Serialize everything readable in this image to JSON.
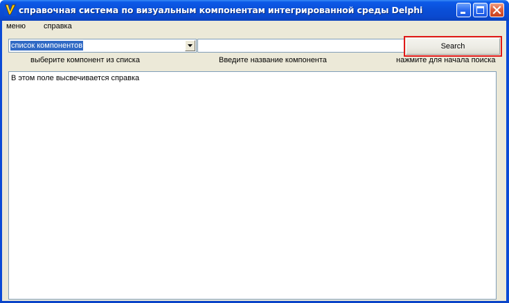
{
  "window": {
    "title": "справочная система по визуальным компонентам интегрированной среды Delphi",
    "icon": "delphi-app-icon",
    "controls": {
      "minimize_icon": "minimize-icon",
      "maximize_icon": "maximize-icon",
      "close_icon": "close-icon"
    },
    "colors": {
      "titlebar": "#0a4fd8",
      "client_bg": "#ece9d8",
      "selection": "#316ac5",
      "highlight_border": "#e01818"
    }
  },
  "menu": {
    "items": [
      {
        "label": "меню"
      },
      {
        "label": "справка"
      }
    ]
  },
  "toolbar": {
    "component_select": {
      "selected": "список компонентов"
    },
    "search_input": {
      "value": "",
      "placeholder": ""
    },
    "search_button": {
      "label": "Search"
    }
  },
  "hints": {
    "select": "выберите компонент из списка",
    "name": "Введите название компонента",
    "search": "нажмите для начала поиска"
  },
  "help": {
    "text": "В этом поле высвечивается справка"
  }
}
